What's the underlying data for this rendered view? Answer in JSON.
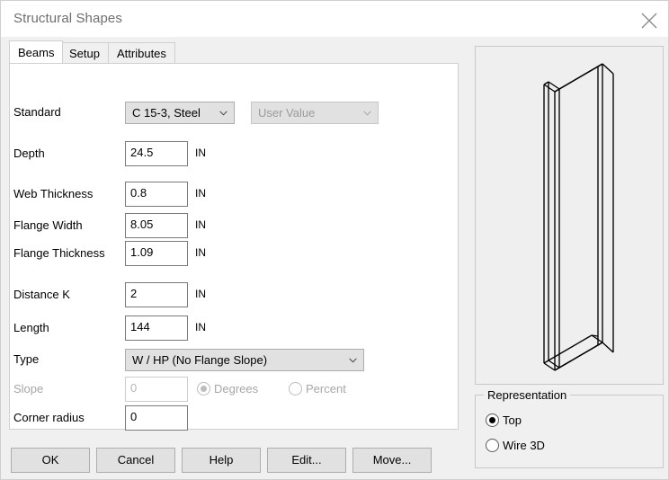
{
  "window": {
    "title": "Structural Shapes",
    "close_icon": "close-icon"
  },
  "tabs": [
    {
      "label": "Beams",
      "active": true
    },
    {
      "label": "Setup",
      "active": false
    },
    {
      "label": "Attributes",
      "active": false
    }
  ],
  "form": {
    "standard": {
      "label": "Standard",
      "combo_value": "C 15-3, Steel",
      "user_value_combo": "User Value",
      "user_value_disabled": true
    },
    "fields": [
      {
        "label": "Depth",
        "value": "24.5",
        "unit": "IN",
        "disabled": false
      },
      {
        "label": "Web Thickness",
        "value": "0.8",
        "unit": "IN",
        "disabled": false
      },
      {
        "label": "Flange Width",
        "value": "8.05",
        "unit": "IN",
        "disabled": false
      },
      {
        "label": "Flange Thickness",
        "value": "1.09",
        "unit": "IN",
        "disabled": false
      },
      {
        "label": "Distance K",
        "value": "2",
        "unit": "IN",
        "disabled": false
      },
      {
        "label": "Length",
        "value": "144",
        "unit": "IN",
        "disabled": false
      }
    ],
    "type": {
      "label": "Type",
      "value": "W / HP (No Flange Slope)"
    },
    "slope": {
      "label": "Slope",
      "value": "0",
      "disabled": true,
      "options": [
        {
          "label": "Degrees",
          "selected": true
        },
        {
          "label": "Percent",
          "selected": false
        }
      ]
    },
    "corner_radius": {
      "label": "Corner radius",
      "value": "0"
    }
  },
  "buttons": [
    {
      "label": "OK"
    },
    {
      "label": "Cancel"
    },
    {
      "label": "Help"
    },
    {
      "label": "Edit..."
    },
    {
      "label": "Move..."
    }
  ],
  "representation": {
    "legend": "Representation",
    "options": [
      {
        "label": "Top",
        "selected": true
      },
      {
        "label": "Wire 3D",
        "selected": false
      }
    ]
  },
  "preview": {
    "shape": "c-channel-isometric-wireframe"
  },
  "colors": {
    "dialog_bg": "#f0f0f0",
    "panel_bg": "#ffffff",
    "control_bg": "#e1e1e1",
    "border": "#adadad",
    "title_text": "#6e6e6e",
    "disabled_text": "#a6a6a6",
    "preview_bg": "#efefef"
  }
}
